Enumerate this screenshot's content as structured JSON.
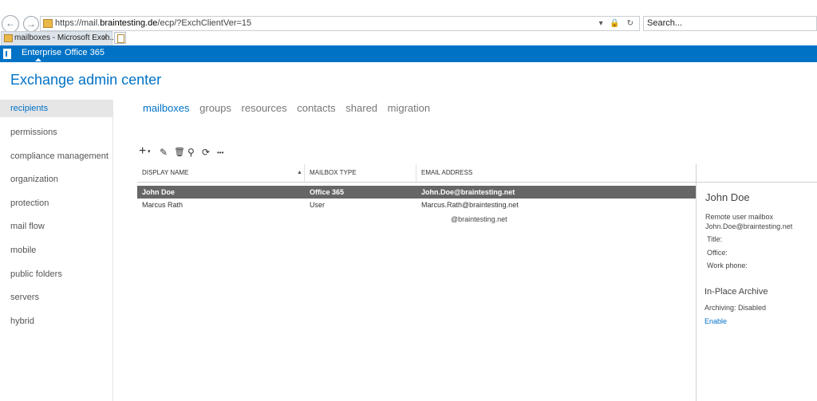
{
  "browser": {
    "url_prefix": "https://mail.",
    "url_domain": "braintesting.de",
    "url_path": "/ecp/?ExchClientVer=15",
    "url_tools": "▾ 🔒 ↻",
    "search_placeholder": "Search...",
    "tab_title": "mailboxes - Microsoft Exch...",
    "tab_close": "✕",
    "back_glyph": "←",
    "fwd_glyph": "→"
  },
  "suitebar": {
    "enterprise": "Enterprise",
    "office365": "Office 365"
  },
  "app": {
    "title": "Exchange admin center"
  },
  "leftnav": {
    "items": [
      {
        "label": "recipients"
      },
      {
        "label": "permissions"
      },
      {
        "label": "compliance management"
      },
      {
        "label": "organization"
      },
      {
        "label": "protection"
      },
      {
        "label": "mail flow"
      },
      {
        "label": "mobile"
      },
      {
        "label": "public folders"
      },
      {
        "label": "servers"
      },
      {
        "label": "hybrid"
      }
    ]
  },
  "subtabs": [
    "mailboxes",
    "groups",
    "resources",
    "contacts",
    "shared",
    "migration"
  ],
  "toolbar": {
    "add": "+",
    "add_arrow": "▾",
    "edit": "✎",
    "delete": "🗑",
    "search": "⚲",
    "refresh": "⟳",
    "more": "•••"
  },
  "grid": {
    "columns": [
      "DISPLAY NAME",
      "MAILBOX TYPE",
      "EMAIL ADDRESS"
    ],
    "sort_glyph": "▲",
    "rows": [
      {
        "name": "John Doe",
        "type": "Office 365",
        "email": "John.Doe@braintesting.net"
      },
      {
        "name": "Marcus Rath",
        "type": "User",
        "email": "Marcus.Rath@braintesting.net"
      }
    ],
    "extra_line": "@braintesting.net"
  },
  "details": {
    "name": "John Doe",
    "kind": "Remote user mailbox",
    "email": "John.Doe@braintesting.net",
    "title_label": "Title:",
    "office_label": "Office:",
    "phone_label": "Work phone:",
    "archive_heading": "In-Place Archive",
    "archiving": "Archiving:  Disabled",
    "enable_link": "Enable"
  }
}
